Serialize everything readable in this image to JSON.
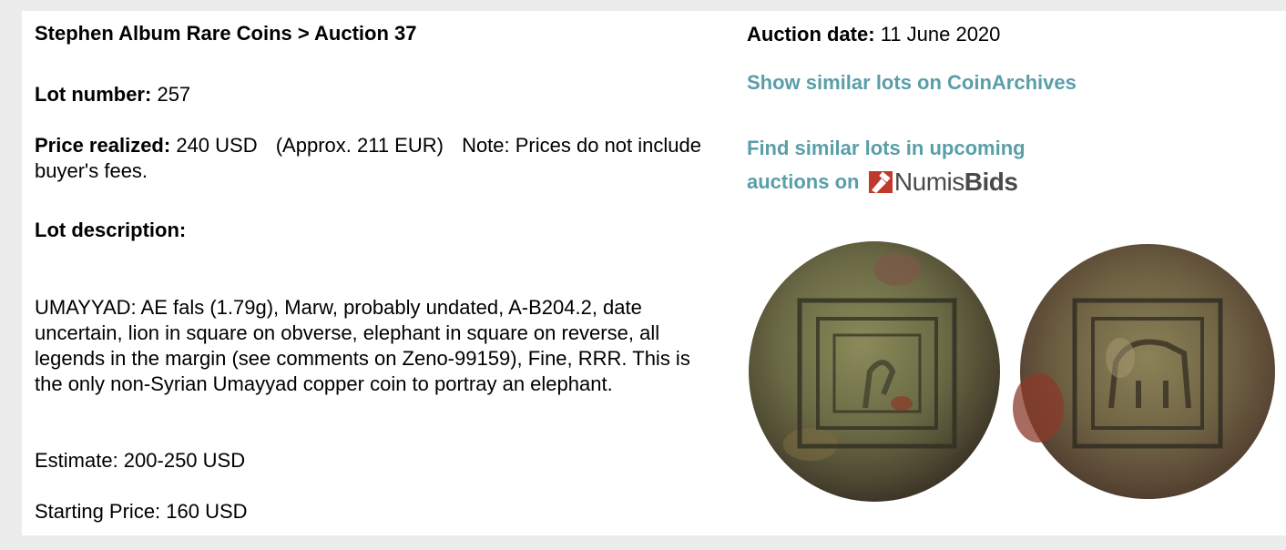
{
  "breadcrumb": "Stephen Album Rare Coins > Auction 37",
  "lot_number": {
    "label": "Lot number:",
    "value": "257"
  },
  "price_realized": {
    "label": "Price realized:",
    "value": "240 USD",
    "approx": "(Approx. 211 EUR)",
    "note": "Note: Prices do not include buyer's fees."
  },
  "lot_description": {
    "label": "Lot description:",
    "text": "UMAYYAD: AE fals (1.79g), Marw, probably undated, A-B204.2, date uncertain, lion in square on obverse, elephant in square on reverse, all legends in the margin (see comments on Zeno-99159), Fine, RRR. This is the only non-Syrian Umayyad copper coin to portray an elephant."
  },
  "estimate": "Estimate: 200-250 USD",
  "starting_price": "Starting Price: 160 USD",
  "auction_date": {
    "label": "Auction date:",
    "value": "11 June 2020"
  },
  "links": {
    "coinarchives": "Show similar lots on CoinArchives",
    "numisbids_prefix": "Find similar lots in upcoming auctions on",
    "numisbids_logo_a": "Numis",
    "numisbids_logo_b": "Bids"
  },
  "colors": {
    "link": "#5a9ea8",
    "logo_red": "#c0392b",
    "logo_gray": "#4a4a4a"
  }
}
